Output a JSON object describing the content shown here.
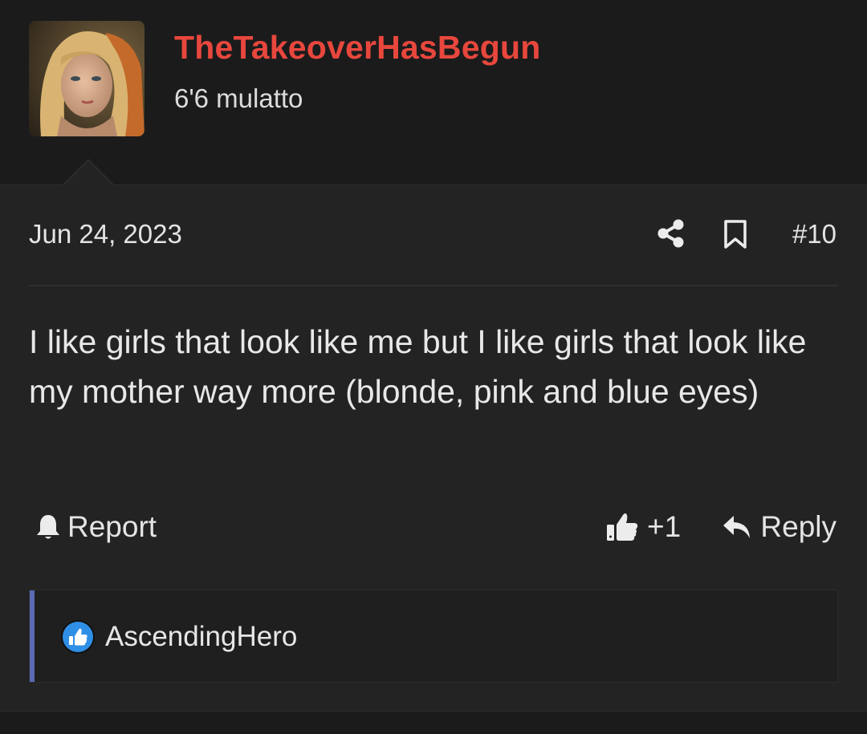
{
  "post": {
    "author": {
      "username": "TheTakeoverHasBegun",
      "user_title": "6'6 mulatto",
      "avatar_icon": "avatar-portrait-icon"
    },
    "date": "Jun 24, 2023",
    "post_number": "#10",
    "message": "I like girls that look like me but I like girls that look like my mother way more (blonde, pink and blue eyes)",
    "actions": {
      "report_label": "Report",
      "like_count": "+1",
      "reply_label": "Reply"
    },
    "reactions": {
      "reactor": "AscendingHero",
      "reaction_icon": "like-reaction-icon"
    }
  },
  "colors": {
    "username": "#e8473d",
    "background": "#1b1b1c",
    "post_background": "#232324",
    "reaction_accent": "#5c6bb5",
    "like_badge": "#2f8fe6"
  }
}
